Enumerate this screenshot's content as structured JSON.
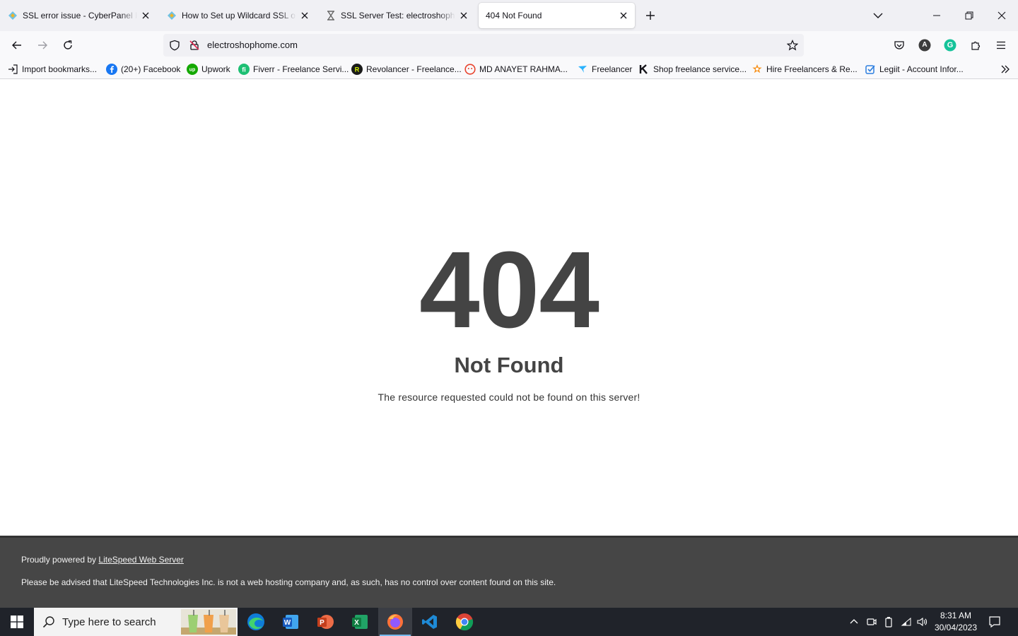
{
  "tabs": [
    {
      "title": "SSL error issue - CyberPanel Pro",
      "icon": "cyberpanel-icon"
    },
    {
      "title": "How to Set up Wildcard SSL on",
      "icon": "cyberpanel-icon"
    },
    {
      "title": "SSL Server Test: electroshophom",
      "icon": "hourglass-icon"
    },
    {
      "title": "404 Not Found",
      "icon": "none",
      "active": true
    }
  ],
  "urlbar": {
    "url": "electroshophome.com"
  },
  "toolbar": {
    "profile_initial": "A",
    "grammarly_initial": "G"
  },
  "bookmarks": [
    {
      "label": "Import bookmarks...",
      "icon": "import-icon"
    },
    {
      "label": "(20+) Facebook",
      "icon": "facebook-icon"
    },
    {
      "label": "Upwork",
      "icon": "upwork-icon"
    },
    {
      "label": "Fiverr - Freelance Servi...",
      "icon": "fiverr-icon"
    },
    {
      "label": "Revolancer - Freelance...",
      "icon": "revolancer-icon"
    },
    {
      "label": "MD ANAYET RAHMA...",
      "icon": "face-icon"
    },
    {
      "label": "Freelancer",
      "icon": "freelancer-icon"
    },
    {
      "label": "Shop freelance service...",
      "icon": "kwork-icon"
    },
    {
      "label": "Hire Freelancers & Re...",
      "icon": "star-burst-icon"
    },
    {
      "label": "Legiit - Account Infor...",
      "icon": "legiit-icon"
    }
  ],
  "page": {
    "code": "404",
    "heading": "Not Found",
    "message": "The resource requested could not be found on this server!"
  },
  "footer": {
    "powered_prefix": "Proudly powered by ",
    "powered_link": "LiteSpeed Web Server",
    "disclaimer": "Please be advised that LiteSpeed Technologies Inc. is not a web hosting company and, as such, has no control over content found on this site."
  },
  "taskbar": {
    "search_placeholder": "Type here to search",
    "time": "8:31 AM",
    "date": "30/04/2023"
  },
  "colors": {
    "text": "#444444",
    "footer_bg": "#464646",
    "taskbar_bg": "#20232a"
  }
}
